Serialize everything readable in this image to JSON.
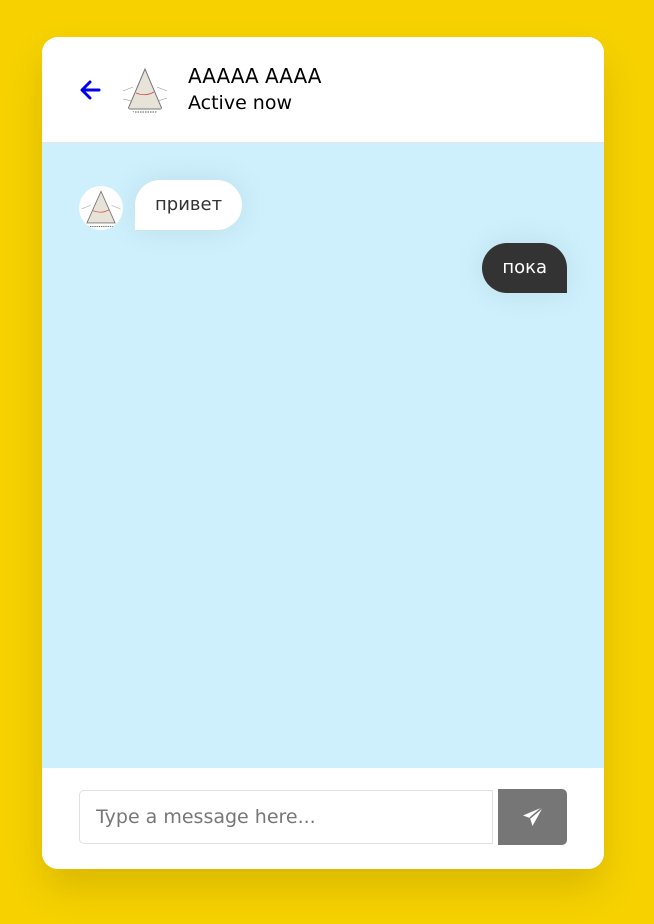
{
  "header": {
    "name": "AAAAA AAAA",
    "status": "Active now",
    "back_icon": "arrow-left-icon",
    "accent_color": "#0000ee"
  },
  "messages": [
    {
      "direction": "incoming",
      "text": "привет"
    },
    {
      "direction": "outgoing",
      "text": "пока"
    }
  ],
  "typing": {
    "placeholder": "Type a message here...",
    "send_icon": "paper-plane-icon"
  },
  "colors": {
    "page_background": "#f7d200",
    "chat_background": "#cdf0fc",
    "outgoing_bubble": "#333333",
    "send_button": "#767676"
  }
}
